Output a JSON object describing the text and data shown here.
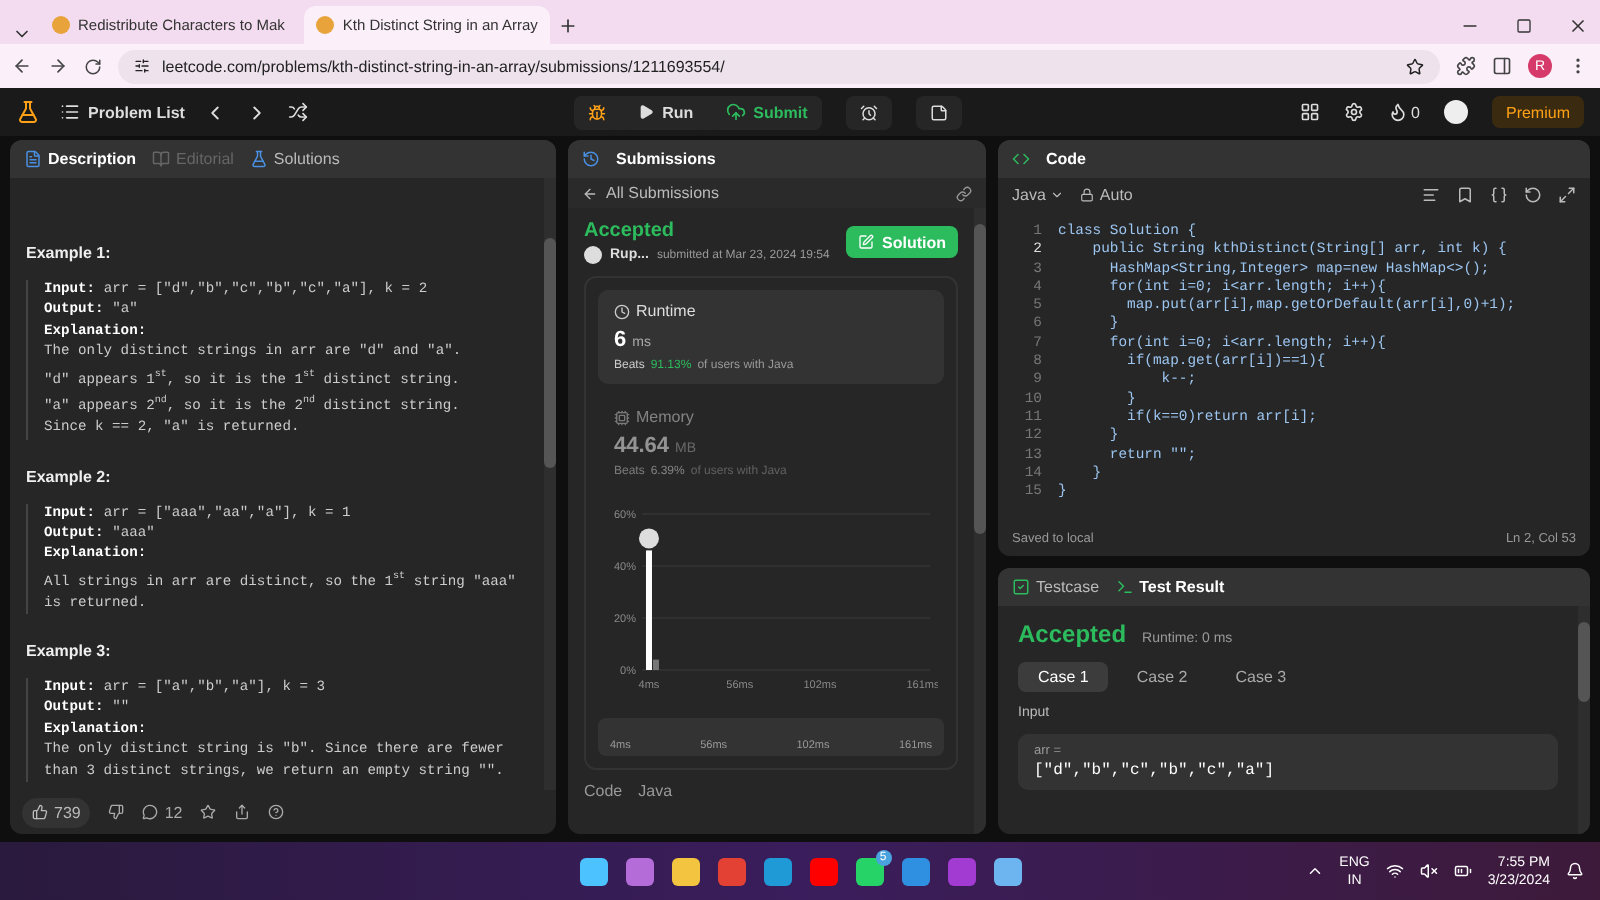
{
  "browser": {
    "tabs": [
      {
        "title": "Redistribute Characters to Mak",
        "selected": false
      },
      {
        "title": "Kth Distinct String in an Array",
        "selected": true
      }
    ],
    "url": "leetcode.com/problems/kth-distinct-string-in-an-array/submissions/1211693554/",
    "profile": "R"
  },
  "header": {
    "problem_list": "Problem List",
    "run": "Run",
    "submit": "Submit",
    "streak": "0",
    "premium": "Premium"
  },
  "description_panel": {
    "tabs": [
      {
        "label": "Description",
        "selected": true,
        "disabled": false
      },
      {
        "label": "Editorial",
        "selected": false,
        "disabled": true
      },
      {
        "label": "Solutions",
        "selected": false,
        "disabled": false
      }
    ],
    "examples": [
      {
        "title": "Example 1:",
        "input_label": "Input:",
        "input": "arr = [\"d\",\"b\",\"c\",\"b\",\"c\",\"a\"], k = 2",
        "output_label": "Output:",
        "output": "\"a\"",
        "explanation_label": "Explanation:",
        "explanation": [
          "The only distinct strings in arr are \"d\" and \"a\".",
          "\"d\" appears 1$^{st}$, so it is the 1$^{st}$ distinct string.",
          "\"a\" appears 2$^{nd}$, so it is the 2$^{nd}$ distinct string.",
          "Since k == 2, \"a\" is returned."
        ]
      },
      {
        "title": "Example 2:",
        "input_label": "Input:",
        "input": "arr = [\"aaa\",\"aa\",\"a\"], k = 1",
        "output_label": "Output:",
        "output": "\"aaa\"",
        "explanation_label": "Explanation:",
        "explanation": [
          "All strings in arr are distinct, so the 1$^{st}$ string \"aaa\"",
          "is returned."
        ]
      },
      {
        "title": "Example 3:",
        "input_label": "Input:",
        "input": "arr = [\"a\",\"b\",\"a\"], k = 3",
        "output_label": "Output:",
        "output": "\"\"",
        "explanation_label": "Explanation:",
        "explanation": [
          "The only distinct string is \"b\". Since there are fewer",
          "than 3 distinct strings, we return an empty string \"\"."
        ]
      }
    ],
    "likes": "739",
    "comments": "12"
  },
  "submissions_panel": {
    "title": "Submissions",
    "back": "All Submissions",
    "status": "Accepted",
    "user": "Rup...",
    "submitted": "submitted at Mar 23, 2024 19:54",
    "solution_button": "Solution",
    "metrics": [
      {
        "kind": "runtime",
        "label": "Runtime",
        "value": "6",
        "unit": "ms",
        "beats_label": "Beats",
        "beats": "91.13%",
        "suffix": "of users with Java",
        "selected": true
      },
      {
        "kind": "memory",
        "label": "Memory",
        "value": "44.64",
        "unit": "MB",
        "beats_label": "Beats",
        "beats": "6.39%",
        "suffix": "of users with Java",
        "selected": false
      }
    ],
    "chart_data": {
      "type": "bar",
      "x": [
        4,
        8
      ],
      "values": [
        46,
        4
      ],
      "xlim": [
        0,
        165
      ],
      "ylim": [
        0,
        60
      ],
      "xticks": [
        {
          "value": 4,
          "label": "4ms"
        },
        {
          "value": 56,
          "label": "56ms"
        },
        {
          "value": 102,
          "label": "102ms"
        },
        {
          "value": 161,
          "label": "161ms"
        }
      ],
      "yticks": [
        {
          "value": 0,
          "label": "0%"
        },
        {
          "value": 20,
          "label": "20%"
        },
        {
          "value": 40,
          "label": "40%"
        },
        {
          "value": 60,
          "label": "60%"
        }
      ]
    },
    "navigator_labels": [
      "4ms",
      "56ms",
      "102ms",
      "161ms"
    ],
    "code_label": "Code",
    "language": "Java"
  },
  "code_panel": {
    "title": "Code",
    "language": "Java",
    "mode": "Auto",
    "lines": [
      {
        "number": "1",
        "text": "class Solution {"
      },
      {
        "number": "2",
        "text": "    public String kthDistinct(String[] arr, int k) {"
      },
      {
        "number": "3",
        "text": "      HashMap<String,Integer> map=new HashMap<>();"
      },
      {
        "number": "4",
        "text": "      for(int i=0; i<arr.length; i++){"
      },
      {
        "number": "5",
        "text": "        map.put(arr[i],map.getOrDefault(arr[i],0)+1);"
      },
      {
        "number": "6",
        "text": "      }"
      },
      {
        "number": "7",
        "text": "      for(int i=0; i<arr.length; i++){"
      },
      {
        "number": "8",
        "text": "        if(map.get(arr[i])==1){"
      },
      {
        "number": "9",
        "text": "            k--;"
      },
      {
        "number": "10",
        "text": "        }"
      },
      {
        "number": "11",
        "text": "        if(k==0)return arr[i];"
      },
      {
        "number": "12",
        "text": "      }"
      },
      {
        "number": "13",
        "text": "      return \"\";"
      },
      {
        "number": "14",
        "text": "    }"
      },
      {
        "number": "15",
        "text": "}"
      }
    ],
    "saved": "Saved to local",
    "cursor": "Ln 2, Col 53"
  },
  "result_panel": {
    "tabs": [
      {
        "label": "Testcase",
        "selected": false
      },
      {
        "label": "Test Result",
        "selected": true
      }
    ],
    "status": "Accepted",
    "runtime": "Runtime: 0 ms",
    "cases": [
      {
        "label": "Case 1",
        "selected": true
      },
      {
        "label": "Case 2",
        "selected": false
      },
      {
        "label": "Case 3",
        "selected": false
      }
    ],
    "input_label": "Input",
    "var_name": "arr =",
    "var_value": "[\"d\",\"b\",\"c\",\"b\",\"c\",\"a\"]"
  },
  "taskbar": {
    "badge": "5",
    "language": "ENG",
    "region": "IN",
    "time": "7:55 PM",
    "date": "3/23/2024"
  }
}
